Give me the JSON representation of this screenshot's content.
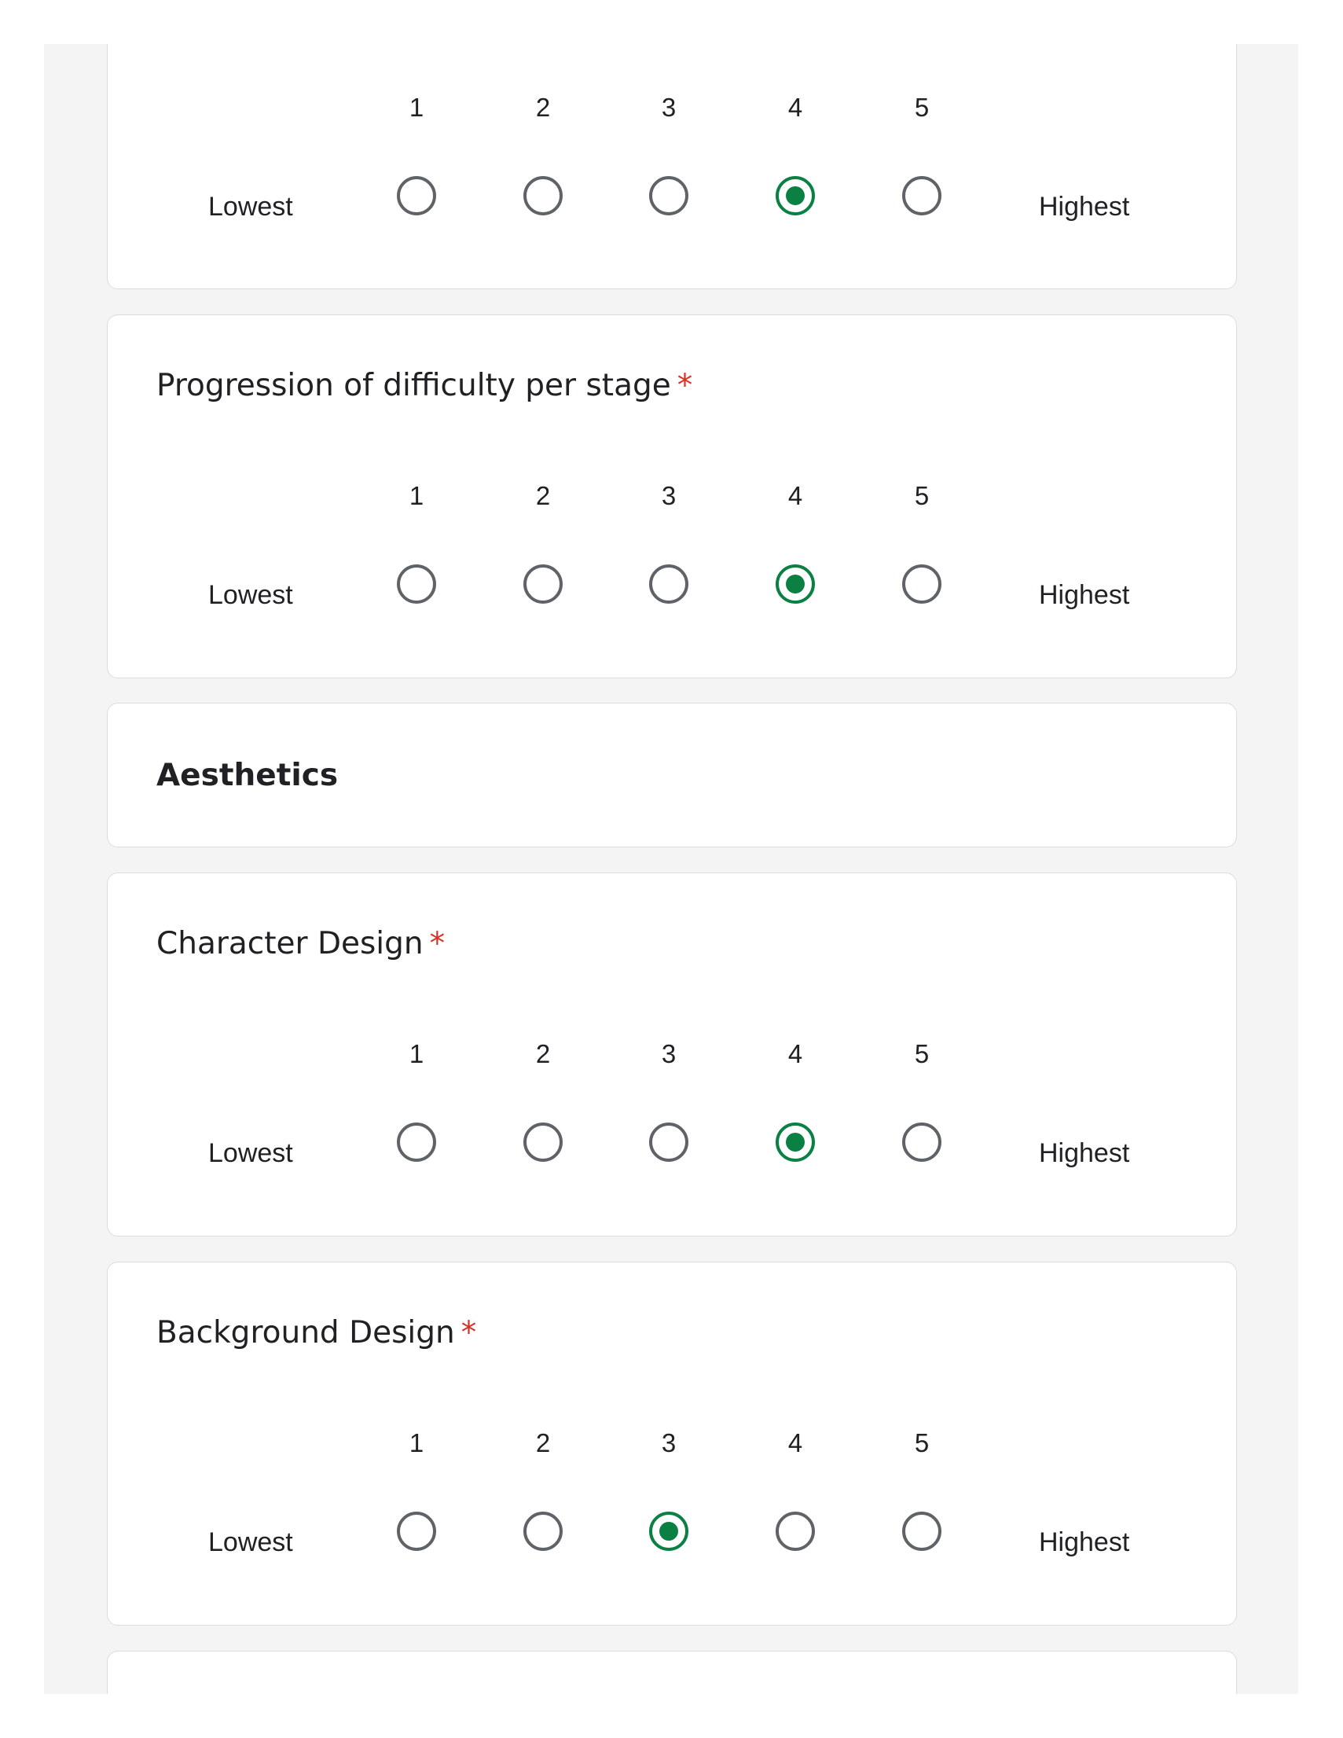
{
  "scale": {
    "numbers": [
      "1",
      "2",
      "3",
      "4",
      "5"
    ],
    "low_label": "Lowest",
    "high_label": "Highest"
  },
  "accent_color": "#0b8043",
  "required_mark": "*",
  "cards": [
    {
      "title": "",
      "selected": 4
    },
    {
      "title": "Progression of difficulty per stage",
      "selected": 4
    },
    {
      "section": "Aesthetics"
    },
    {
      "title": "Character Design",
      "selected": 4
    },
    {
      "title": "Background Design",
      "selected": 3
    }
  ]
}
